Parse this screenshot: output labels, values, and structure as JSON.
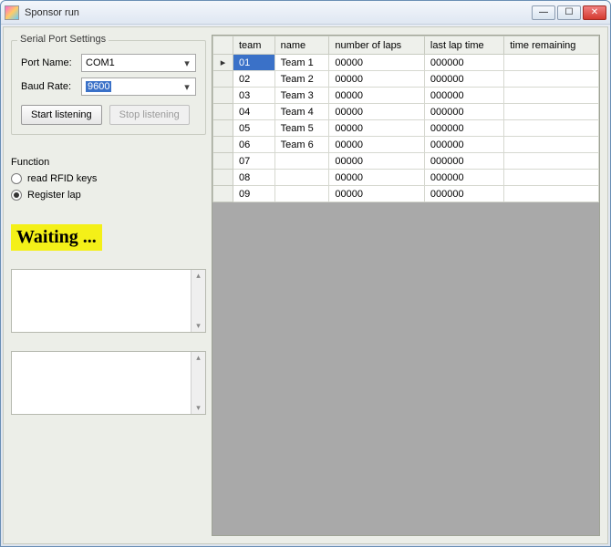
{
  "window": {
    "title": "Sponsor run"
  },
  "serial": {
    "legend": "Serial Port Settings",
    "port_label": "Port Name:",
    "port_value": "COM1",
    "baud_label": "Baud Rate:",
    "baud_value": "9600",
    "start_label": "Start listening",
    "stop_label": "Stop listening"
  },
  "function": {
    "legend": "Function",
    "opt_read": "read RFID keys",
    "opt_register": "Register lap",
    "selected": "register"
  },
  "status_text": "Waiting ...",
  "grid": {
    "columns": [
      "team",
      "name",
      "number of laps",
      "last lap time",
      "time remaining"
    ],
    "rows": [
      {
        "team": "01",
        "name": "Team 1",
        "laps": "00000",
        "last": "000000",
        "remain": ""
      },
      {
        "team": "02",
        "name": "Team 2",
        "laps": "00000",
        "last": "000000",
        "remain": ""
      },
      {
        "team": "03",
        "name": "Team 3",
        "laps": "00000",
        "last": "000000",
        "remain": ""
      },
      {
        "team": "04",
        "name": "Team 4",
        "laps": "00000",
        "last": "000000",
        "remain": ""
      },
      {
        "team": "05",
        "name": "Team 5",
        "laps": "00000",
        "last": "000000",
        "remain": ""
      },
      {
        "team": "06",
        "name": "Team 6",
        "laps": "00000",
        "last": "000000",
        "remain": ""
      },
      {
        "team": "07",
        "name": "",
        "laps": "00000",
        "last": "000000",
        "remain": ""
      },
      {
        "team": "08",
        "name": "",
        "laps": "00000",
        "last": "000000",
        "remain": ""
      },
      {
        "team": "09",
        "name": "",
        "laps": "00000",
        "last": "000000",
        "remain": ""
      }
    ],
    "selected_row": 0
  }
}
